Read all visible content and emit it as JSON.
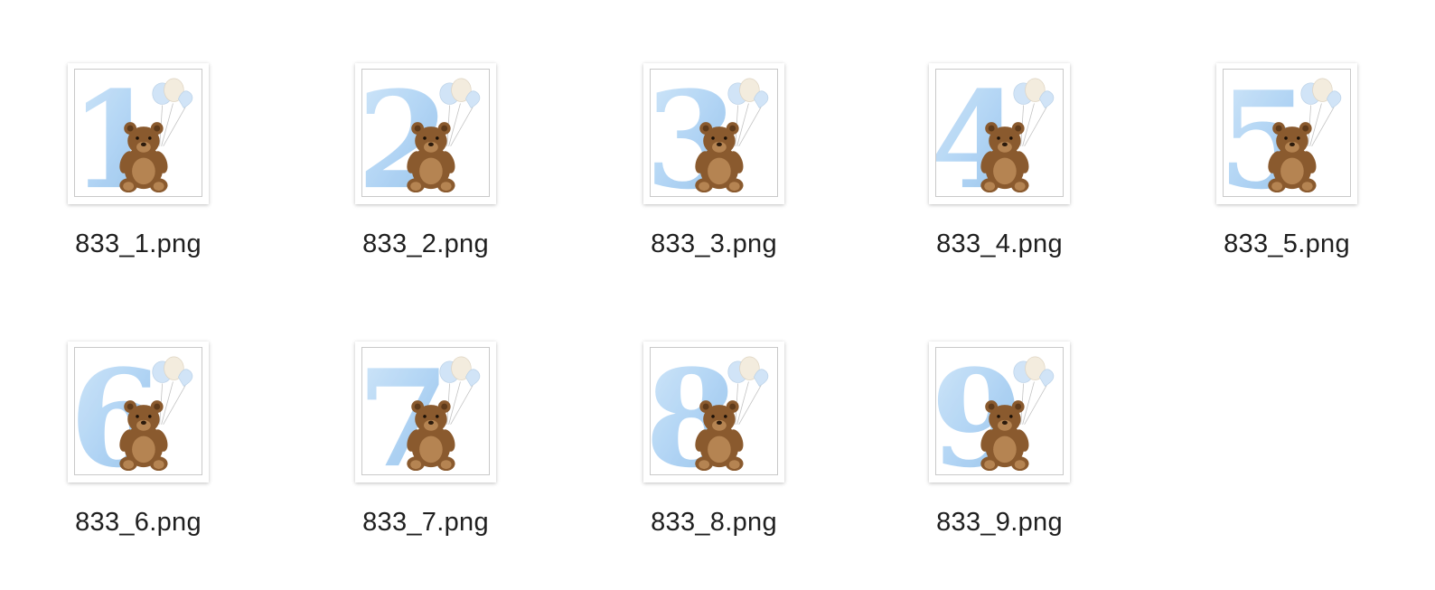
{
  "window": {
    "view": "icon-view"
  },
  "files": [
    {
      "name": "833_1.png",
      "glyph": "1",
      "icon": "teddy-bear-number-one-thumbnail"
    },
    {
      "name": "833_2.png",
      "glyph": "2",
      "icon": "teddy-bear-number-two-thumbnail"
    },
    {
      "name": "833_3.png",
      "glyph": "3",
      "icon": "teddy-bear-number-three-thumbnail"
    },
    {
      "name": "833_4.png",
      "glyph": "4",
      "icon": "teddy-bear-number-four-thumbnail"
    },
    {
      "name": "833_5.png",
      "glyph": "5",
      "icon": "teddy-bear-number-five-thumbnail"
    },
    {
      "name": "833_6.png",
      "glyph": "6",
      "icon": "teddy-bear-number-six-thumbnail"
    },
    {
      "name": "833_7.png",
      "glyph": "7",
      "icon": "teddy-bear-number-seven-thumbnail"
    },
    {
      "name": "833_8.png",
      "glyph": "8",
      "icon": "teddy-bear-number-eight-thumbnail"
    },
    {
      "name": "833_9.png",
      "glyph": "9",
      "icon": "teddy-bear-number-nine-thumbnail"
    }
  ],
  "colors": {
    "digit_light": "#cfe6fa",
    "digit_mid": "#a9d0f3",
    "digit_dark": "#86b8e6",
    "bear_fur": "#8a5a2e",
    "bear_dark": "#5e3a1a",
    "bear_light": "#b58452",
    "balloon_blue": "#cfe3f7",
    "balloon_cream": "#f3ebdd"
  }
}
